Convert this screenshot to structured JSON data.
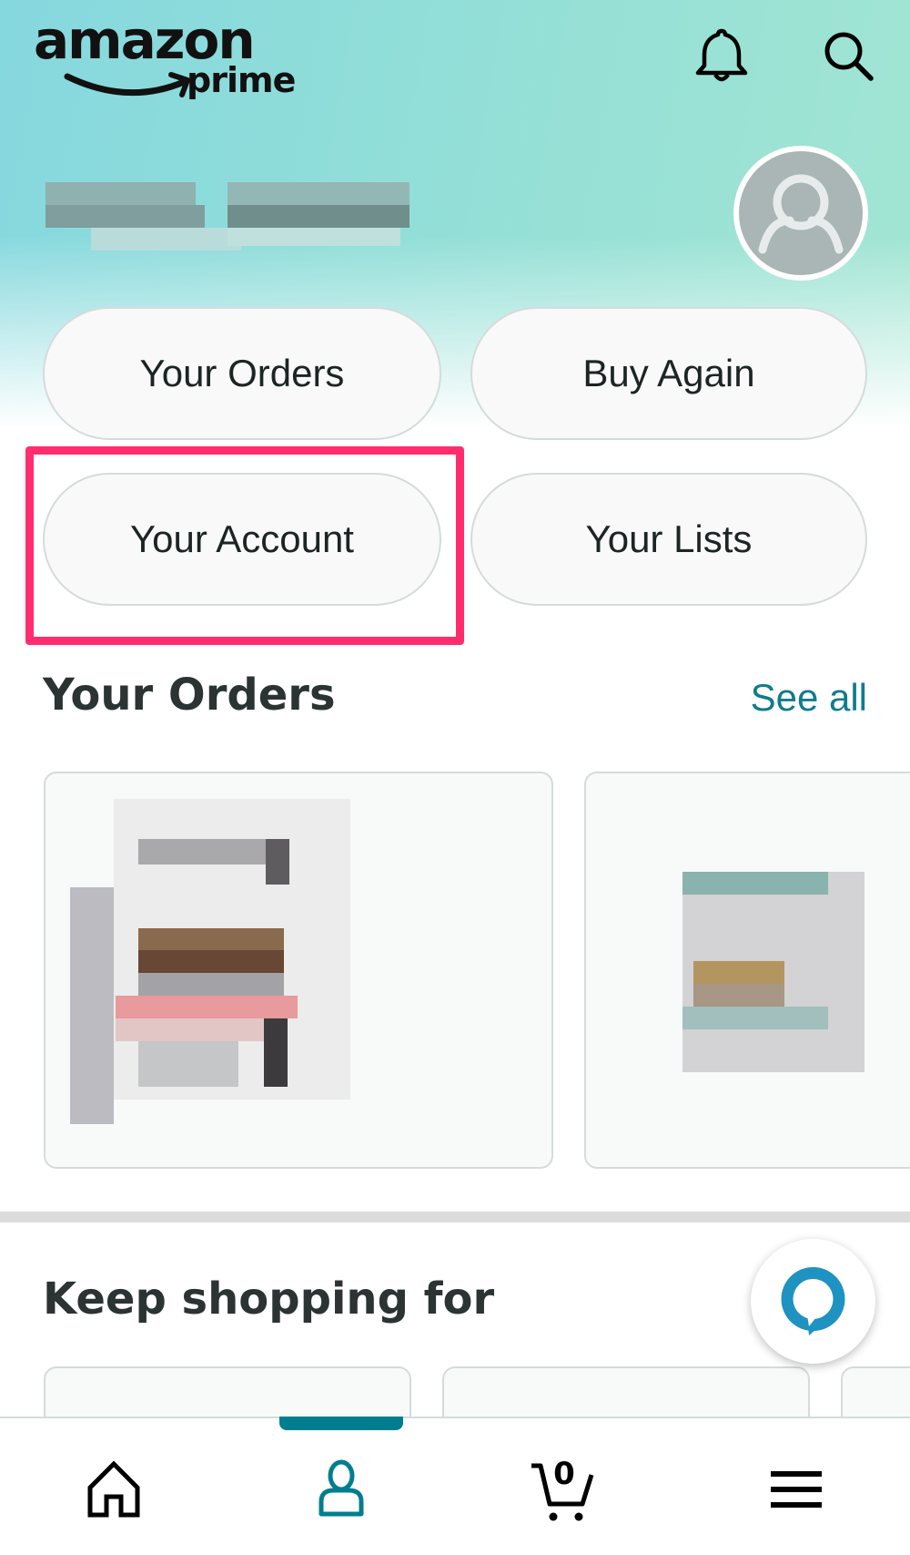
{
  "header": {
    "logo_main": "amazon",
    "logo_sub": "prime",
    "notifications_icon": "bell-icon",
    "search_icon": "search-icon"
  },
  "profile": {
    "user_name_redacted": true,
    "avatar_icon": "user-avatar-icon"
  },
  "quick_actions": [
    {
      "label": "Your Orders"
    },
    {
      "label": "Buy Again"
    },
    {
      "label": "Your Account",
      "highlighted": true
    },
    {
      "label": "Your Lists"
    }
  ],
  "orders_section": {
    "title": "Your Orders",
    "see_all_label": "See all"
  },
  "keep_shopping_section": {
    "title": "Keep shopping for"
  },
  "alexa": {
    "icon": "alexa-icon",
    "color": "#1e92c0"
  },
  "bottom_nav": {
    "items": [
      {
        "name": "home",
        "icon": "home-icon",
        "active": false
      },
      {
        "name": "you",
        "icon": "person-icon",
        "active": true
      },
      {
        "name": "cart",
        "icon": "cart-icon",
        "active": false,
        "count": "0"
      },
      {
        "name": "menu",
        "icon": "menu-icon",
        "active": false
      }
    ],
    "active_color": "#007e8f"
  },
  "colors": {
    "highlight": "#ff2d6e",
    "link": "#0f7c8c",
    "hero_gradient_start": "#86d8df",
    "hero_gradient_end": "#a2e5d3"
  }
}
